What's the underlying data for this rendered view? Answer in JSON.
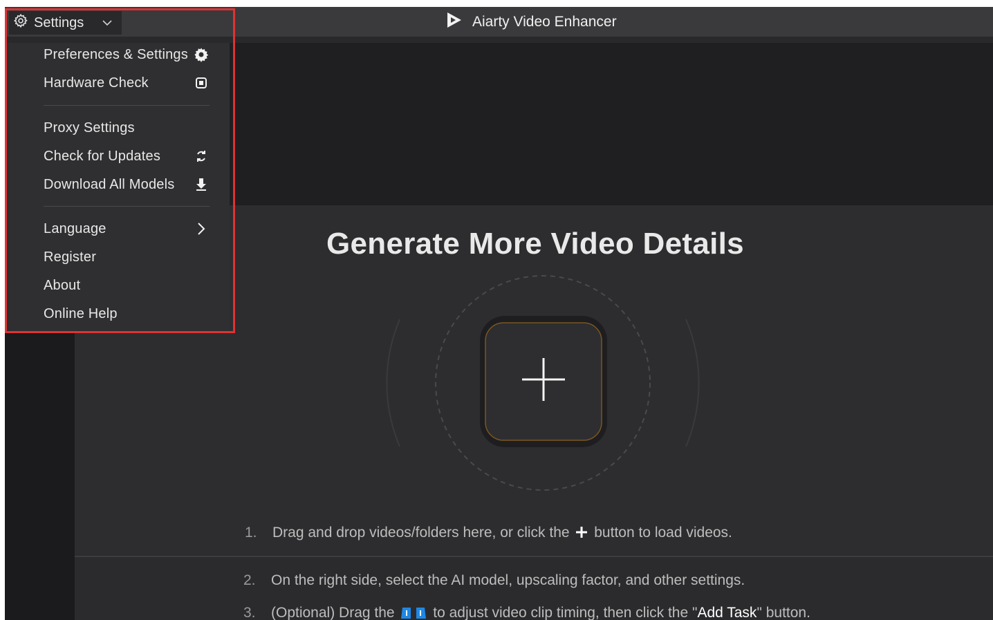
{
  "titlebar": {
    "settings_label": "Settings",
    "app_title": "Aiarty Video Enhancer"
  },
  "menu": {
    "items": [
      {
        "label": "Preferences & Settings",
        "icon": "gear-icon"
      },
      {
        "label": "Hardware Check",
        "icon": "chip-icon"
      },
      {
        "label": "Proxy Settings",
        "icon": ""
      },
      {
        "label": "Check for Updates",
        "icon": "refresh-icon"
      },
      {
        "label": "Download All Models",
        "icon": "download-icon"
      },
      {
        "label": "Language",
        "icon": "chevron-right-icon"
      },
      {
        "label": "Register",
        "icon": ""
      },
      {
        "label": "About",
        "icon": ""
      },
      {
        "label": "Online Help",
        "icon": ""
      }
    ]
  },
  "main": {
    "headline": "Generate More Video Details",
    "steps": [
      {
        "num": "1.",
        "text_before": "Drag and drop videos/folders here, or click the",
        "text_after": "button to load videos."
      },
      {
        "num": "2.",
        "text": "On the right side, select the AI model, upscaling factor, and other settings."
      },
      {
        "num": "3.",
        "text_before": "(Optional) Drag the",
        "text_mid": "to adjust video clip timing, then click the \"",
        "highlight": "Add Task",
        "text_after": "\" button."
      }
    ]
  },
  "colors": {
    "highlight_box": "#e03232",
    "brand_blue": "#1e88e5",
    "accent_orange": "#8a5a1e"
  }
}
